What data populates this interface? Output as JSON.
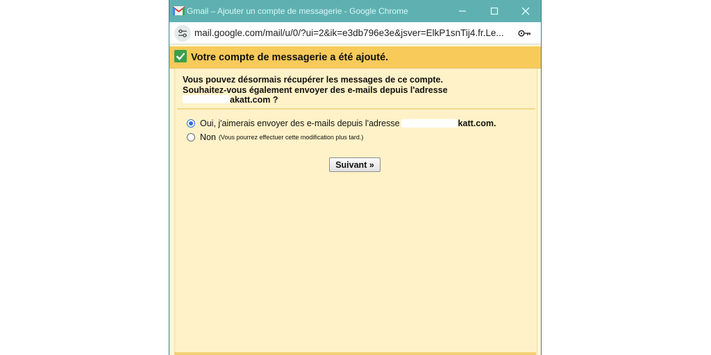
{
  "window": {
    "title": "Gmail – Ajouter un compte de messagerie - Google Chrome",
    "url": "mail.google.com/mail/u/0/?ui=2&ik=e3db796e3e&jsver=ElkP1snTij4.fr.Le..."
  },
  "icons": {
    "app": "gmail-logo-icon",
    "minimize": "minimize-icon",
    "maximize": "maximize-icon",
    "close": "close-icon",
    "site_info": "site-settings-icon",
    "password": "key-icon",
    "success": "checkmark-icon"
  },
  "header": {
    "title": "Votre compte de messagerie a été ajouté."
  },
  "intro": {
    "line1": "Vous pouvez désormais récupérer les messages de ce compte.",
    "line2": "Souhaitez-vous également envoyer des e-mails depuis l'adresse",
    "email_suffix": "akatt.com ?"
  },
  "options": {
    "yes_label": "Oui, j'aimerais envoyer des e-mails depuis l'adresse",
    "yes_email_suffix": "katt.com.",
    "no_label": "Non",
    "no_note": "(Vous pourrez effectuer cette modification plus tard.)",
    "selected": "yes"
  },
  "next_button": "Suivant »",
  "colors": {
    "titlebar": "#5fb1b1",
    "header_band": "#f8ca5a",
    "content_bg": "#fff2c8",
    "check_green": "#38a04c",
    "radio_blue": "#2e6fd8"
  }
}
